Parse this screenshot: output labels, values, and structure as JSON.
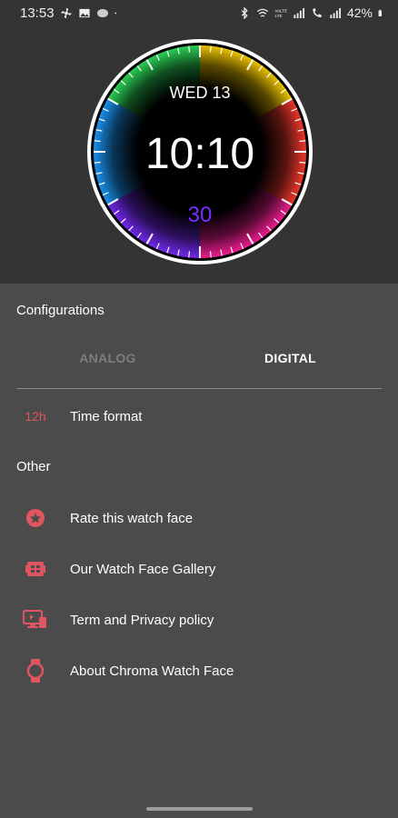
{
  "status_bar": {
    "time": "13:53",
    "battery": "42%",
    "left_icons": [
      "fan-icon",
      "image-icon",
      "meeting-icon",
      "dot-icon"
    ],
    "right_icons": [
      "bluetooth-icon",
      "wifi-icon",
      "volte-icon",
      "signal-icon",
      "call-icon",
      "signal-icon",
      "battery-icon"
    ]
  },
  "watch_preview": {
    "date": "WED 13",
    "time": "10:10",
    "seconds": "30",
    "seconds_color": "#7b2cff"
  },
  "configurations": {
    "title": "Configurations",
    "tabs": [
      {
        "label": "ANALOG",
        "selected": false
      },
      {
        "label": "DIGITAL",
        "selected": true
      }
    ],
    "items": [
      {
        "icon_text": "12h",
        "label": "Time format"
      }
    ]
  },
  "other": {
    "title": "Other",
    "items": [
      {
        "icon": "star-circle-icon",
        "label": "Rate this watch face"
      },
      {
        "icon": "gallery-icon",
        "label": "Our Watch Face Gallery"
      },
      {
        "icon": "screen-policy-icon",
        "label": "Term and Privacy policy"
      },
      {
        "icon": "watch-icon",
        "label": "About Chroma Watch Face"
      }
    ]
  },
  "colors": {
    "accent": "#e05560",
    "background": "#4b4b4b",
    "header_background": "#343434"
  }
}
